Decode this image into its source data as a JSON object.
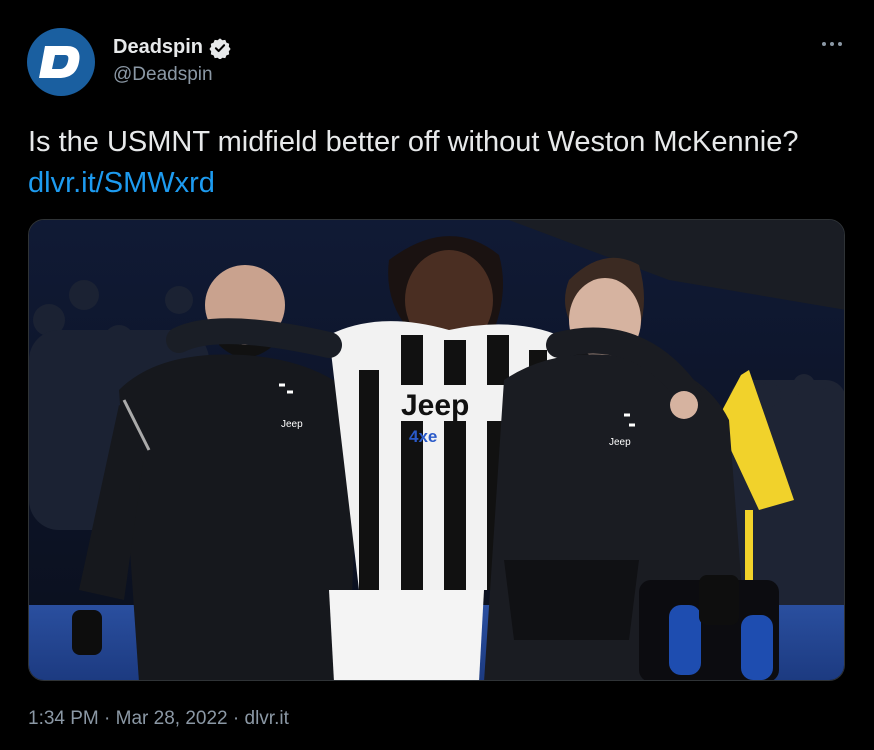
{
  "author": {
    "display_name": "Deadspin",
    "handle": "@Deadspin",
    "avatar_letter": "D",
    "verified": true
  },
  "tweet": {
    "text": "Is the USMNT midfield better off without Weston McKennie? ",
    "link_text": "dlvr.it/SMWxrd"
  },
  "media": {
    "jersey_sponsor": "Jeep",
    "jersey_sponsor_sub": "4xe",
    "staff_badge": "Jeep"
  },
  "meta": {
    "time": "1:34 PM",
    "separator": " · ",
    "date": "Mar 28, 2022",
    "source": "dlvr.it"
  },
  "colors": {
    "background": "#000000",
    "text": "#e7e9ea",
    "secondary": "#8b98a5",
    "link": "#1d9bf0",
    "avatar": "#1a5fa0"
  },
  "icons": [
    "deadspin-logo-icon",
    "verified-badge-icon",
    "more-options-icon"
  ]
}
